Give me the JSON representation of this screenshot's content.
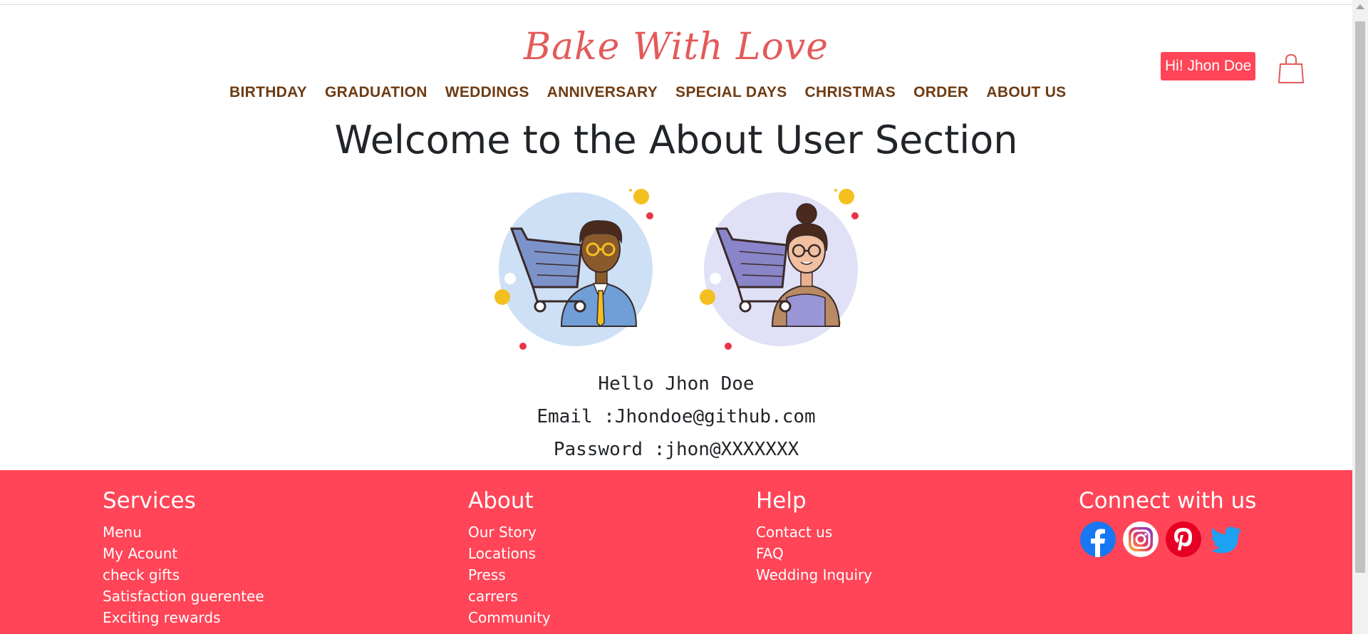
{
  "brand": {
    "logo_text": "Bake With Love"
  },
  "nav": {
    "items": [
      "BIRTHDAY",
      "GRADUATION",
      "WEDDINGS",
      "ANNIVERSARY",
      "SPECIAL DAYS",
      "CHRISTMAS",
      "ORDER",
      "ABOUT US"
    ]
  },
  "header": {
    "greeting": "Hi! Jhon Doe",
    "cart_icon": "shopping-bag-icon"
  },
  "main": {
    "title": "Welcome to the About User Section",
    "hello": "Hello Jhon Doe",
    "email_line": "Email :Jhondoe@github.com",
    "password_line": "Password :jhon@XXXXXXX"
  },
  "footer": {
    "services": {
      "title": "Services",
      "links": [
        "Menu",
        "My Acount",
        "check gifts",
        "Satisfaction guerentee",
        "Exciting rewards"
      ]
    },
    "about": {
      "title": "About",
      "links": [
        "Our Story",
        "Locations",
        "Press",
        "carrers",
        "Community"
      ]
    },
    "help": {
      "title": "Help",
      "links": [
        "Contact us",
        "FAQ",
        "Wedding Inquiry"
      ]
    },
    "connect": {
      "title": "Connect with us",
      "icons": [
        "facebook-icon",
        "instagram-icon",
        "pinterest-icon",
        "twitter-icon"
      ]
    }
  },
  "colors": {
    "accent": "#ff4557",
    "nav_text": "#6e3b12",
    "logo": "#e35a5a"
  }
}
